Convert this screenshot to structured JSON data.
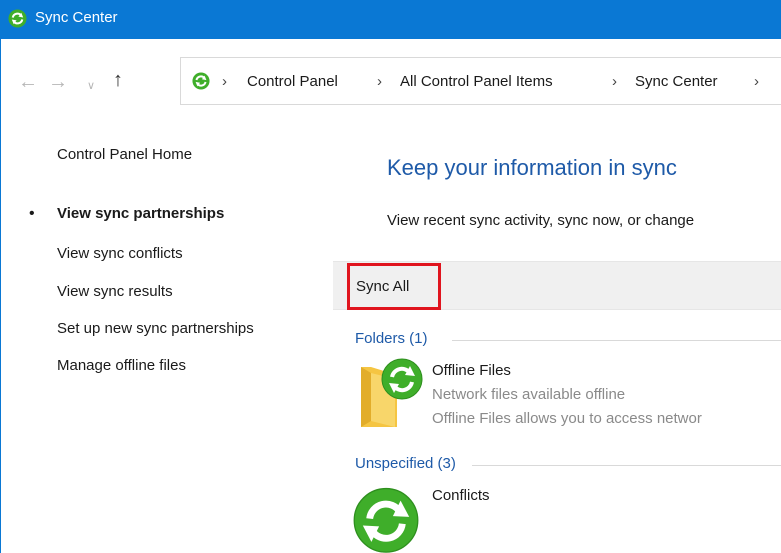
{
  "window": {
    "title": "Sync Center"
  },
  "breadcrumbs": [
    "Control Panel",
    "All Control Panel Items",
    "Sync Center"
  ],
  "left_pane": {
    "home": "Control Panel Home",
    "links": [
      "View sync partnerships",
      "View sync conflicts",
      "View sync results",
      "Set up new sync partnerships",
      "Manage offline files"
    ]
  },
  "main": {
    "heading": "Keep your information in sync",
    "subtext": "View recent sync activity, sync now, or change"
  },
  "toolbar": {
    "sync_all": "Sync All"
  },
  "groups": [
    {
      "header": "Folders (1)",
      "items": [
        {
          "title": "Offline Files",
          "line1": "Network files available offline",
          "line2": "Offline Files allows you to access networ"
        }
      ]
    },
    {
      "header": "Unspecified (3)",
      "items": [
        {
          "title": "Conflicts"
        }
      ]
    }
  ],
  "colors": {
    "titlebar": "#0a78d4",
    "heading": "#1e5aa8",
    "highlight": "#e0141e"
  }
}
